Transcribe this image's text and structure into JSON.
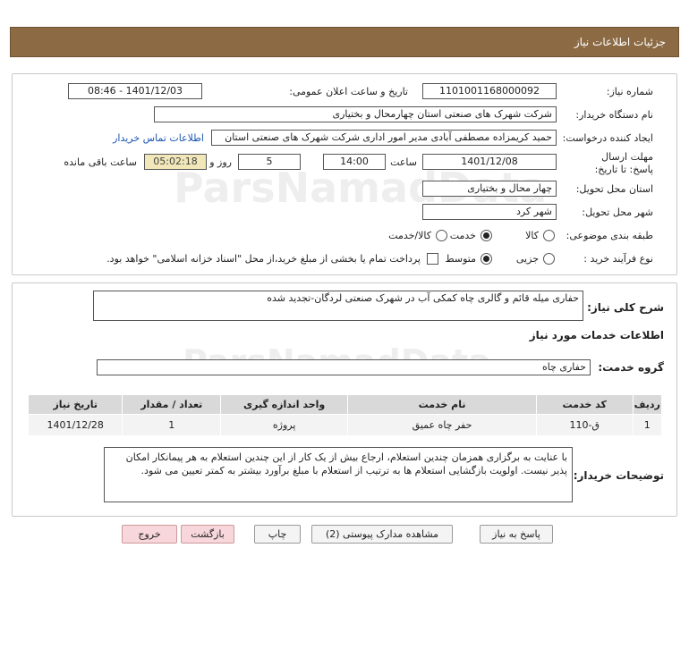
{
  "header": {
    "title": "جزئیات اطلاعات نیاز"
  },
  "form": {
    "need_number_label": "شماره نیاز:",
    "need_number": "1101001168000092",
    "announce_label": "تاریخ و ساعت اعلان عمومی:",
    "announce_value": "1401/12/03 - 08:46",
    "buyer_label": "نام دستگاه خریدار:",
    "buyer_value": "شرکت شهرک های صنعتی استان چهارمحال و بختیاری",
    "creator_label": "ایجاد کننده درخواست:",
    "creator_value": "حمید کریمزاده مصطفی آبادی مدیر امور اداری شرکت شهرک های صنعتی استان",
    "contact_link": "اطلاعات تماس خریدار",
    "deadline_label": "مهلت ارسال پاسخ: تا تاریخ:",
    "deadline_date": "1401/12/08",
    "time_label": "ساعت",
    "deadline_time": "14:00",
    "days_value": "5",
    "days_label": "روز و",
    "remaining_value": "05:02:18",
    "remaining_label": "ساعت باقی مانده",
    "province_label": "استان محل تحویل:",
    "province_value": "چهار محال و بختیاری",
    "city_label": "شهر محل تحویل:",
    "city_value": "شهر کرد",
    "category_label": "طبقه بندی موضوعی:",
    "category_options": [
      "کالا",
      "خدمت",
      "کالا/خدمت"
    ],
    "process_label": "نوع فرآیند خرید :",
    "process_options": [
      "جزیی",
      "متوسط"
    ],
    "payment_note": "پرداخت تمام یا بخشی از مبلغ خرید،از محل \"اسناد خزانه اسلامی\" خواهد بود."
  },
  "details": {
    "summary_label": "شرح کلی نیاز:",
    "summary_value": "حفاری میله قائم و گالری چاه کمکی آب در شهرک صنعتی لردگان-تجدید شده",
    "services_heading": "اطلاعات خدمات مورد نیاز",
    "service_group_label": "گروه خدمت:",
    "service_group_value": "حفاری چاه",
    "table": {
      "headers": [
        "ردیف",
        "کد خدمت",
        "نام خدمت",
        "واحد اندازه گیری",
        "تعداد / مقدار",
        "تاریخ نیاز"
      ],
      "rows": [
        [
          "1",
          "ق-110",
          "حفر چاه عمیق",
          "پروژه",
          "1",
          "1401/12/28"
        ]
      ]
    },
    "notes_label": "توضیحات خریدار:",
    "notes_value": "با عنایت به برگزاری همزمان چندین استعلام، ارجاع بیش از یک کار از این چندین استعلام به هر پیمانکار امکان پذیر نیست. اولویت بازگشایی استعلام ها به ترتیب از استعلام با مبلغ برآورد بیشتر به کمتر تعیین می شود."
  },
  "buttons": {
    "reply": "پاسخ به نیاز",
    "attachments": "مشاهده مدارک پیوستی (2)",
    "print": "چاپ",
    "back": "بازگشت",
    "exit": "خروج"
  },
  "watermark": {
    "text": "ParsNamadData"
  }
}
